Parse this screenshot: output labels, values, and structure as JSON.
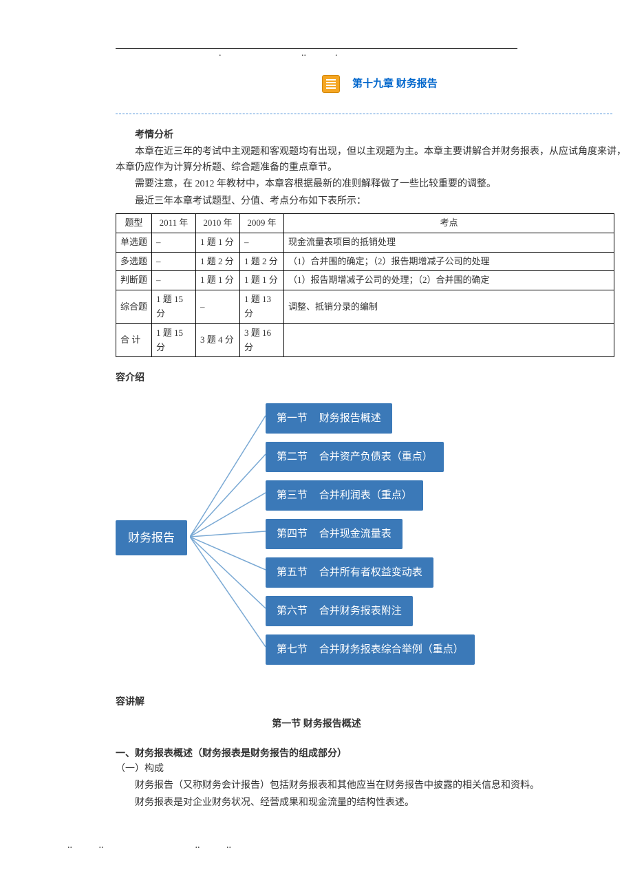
{
  "chapter": {
    "title": "第十九章   财务报告"
  },
  "analysis": {
    "heading": "考情分析",
    "p1": "本章在近三年的考试中主观题和客观题均有出现，但以主观题为主。本章主要讲解合并财务报表，从应试角度来讲，本章仍应作为计算分析题、综合题准备的重点章节。",
    "p2": "需要注意，在 2012 年教材中，本章容根据最新的准则解释做了一些比较重要的调整。",
    "p3": "最近三年本章考试题型、分值、考点分布如下表所示："
  },
  "table": {
    "headers": [
      "题型",
      "2011 年",
      "2010 年",
      "2009 年",
      "考点"
    ],
    "rows": [
      [
        "单选题",
        "–",
        "1 题 1 分",
        "–",
        "现金流量表项目的抵销处理"
      ],
      [
        "多选题",
        "–",
        "1 题 2 分",
        "1 题 2 分",
        "（1）合并围的确定；（2）报告期增减子公司的处理"
      ],
      [
        "判断题",
        "–",
        "1 题 1 分",
        "1 题 1 分",
        "（1）报告期增减子公司的处理；（2）合并围的确定"
      ],
      [
        "综合题",
        "1 题 15 分",
        "–",
        "1 题 13 分",
        "调整、抵销分录的编制"
      ],
      [
        "合 计",
        "1 题 15 分",
        "3 题 4 分",
        "3 题 16 分",
        ""
      ]
    ]
  },
  "intro_heading": "容介绍",
  "diagram": {
    "root": "财务报告",
    "sections": [
      {
        "num": "第一节",
        "title": "财务报告概述"
      },
      {
        "num": "第二节",
        "title": "合并资产负债表（重点）"
      },
      {
        "num": "第三节",
        "title": "合并利润表（重点）"
      },
      {
        "num": "第四节",
        "title": "合并现金流量表"
      },
      {
        "num": "第五节",
        "title": "合并所有者权益变动表"
      },
      {
        "num": "第六节",
        "title": "合并财务报表附注"
      },
      {
        "num": "第七节",
        "title": "合并财务报表综合举例（重点）"
      }
    ]
  },
  "explain_heading": "容讲解",
  "section1": {
    "title": "第一节   财务报告概述",
    "h1": "一、财务报表概述（财务报表是财务报告的组成部分）",
    "h2": "（一）构成",
    "p1": "财务报告（又称财务会计报告）包括财务报表和其他应当在财务报告中披露的相关信息和资料。",
    "p2": "财务报表是对企业财务状况、经营成果和现金流量的结构性表述。"
  },
  "footer_dots": "..           ..                                      ..           .."
}
